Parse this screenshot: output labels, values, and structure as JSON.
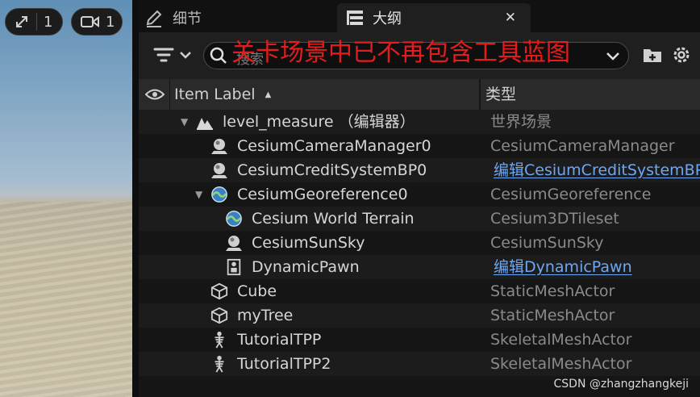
{
  "viewport": {
    "scale_label": "1",
    "camera_label": "1",
    "scale_icon": "expand-arrows-icon",
    "camera_icon": "video-camera-icon"
  },
  "tabs": [
    {
      "label": "细节",
      "icon": "pencil-icon"
    },
    {
      "label": "大纲",
      "icon": "outliner-icon",
      "close": "✕"
    }
  ],
  "search": {
    "placeholder": "搜索",
    "overlay_annotation": "关卡场景中已不再包含工具蓝图"
  },
  "columns": {
    "label_header": "Item Label",
    "sort_indicator": "▲",
    "type_header": "类型"
  },
  "rows": [
    {
      "label": "level_measure （编辑器）",
      "type": "世界场景",
      "icon": "level-icon",
      "expanded": true,
      "link": false
    },
    {
      "label": "CesiumCameraManager0",
      "type": "CesiumCameraManager",
      "icon": "actor-sphere-icon",
      "link": false
    },
    {
      "label": "CesiumCreditSystemBP0",
      "type": "编辑CesiumCreditSystemBP",
      "icon": "actor-sphere-icon",
      "link": true
    },
    {
      "label": "CesiumGeoreference0",
      "type": "CesiumGeoreference",
      "icon": "globe-icon",
      "expanded": true,
      "link": false
    },
    {
      "label": "Cesium World Terrain",
      "type": "Cesium3DTileset",
      "icon": "globe-icon",
      "link": false
    },
    {
      "label": "CesiumSunSky",
      "type": "CesiumSunSky",
      "icon": "actor-sphere-icon",
      "link": false
    },
    {
      "label": "DynamicPawn",
      "type": "编辑DynamicPawn",
      "icon": "pawn-icon",
      "link": true
    },
    {
      "label": "Cube",
      "type": "StaticMeshActor",
      "icon": "cube-icon",
      "link": false
    },
    {
      "label": "myTree",
      "type": "StaticMeshActor",
      "icon": "cube-icon",
      "link": false
    },
    {
      "label": "TutorialTPP",
      "type": "SkeletalMeshActor",
      "icon": "skeleton-icon",
      "link": false
    },
    {
      "label": "TutorialTPP2",
      "type": "SkeletalMeshActor",
      "icon": "skeleton-icon",
      "link": false
    }
  ],
  "watermark": "CSDN @zhangzhangkeji",
  "colors": {
    "annotation_red": "#e31d1d",
    "link_blue": "#6ea7f3",
    "panel_bg": "#1f1f1f"
  }
}
